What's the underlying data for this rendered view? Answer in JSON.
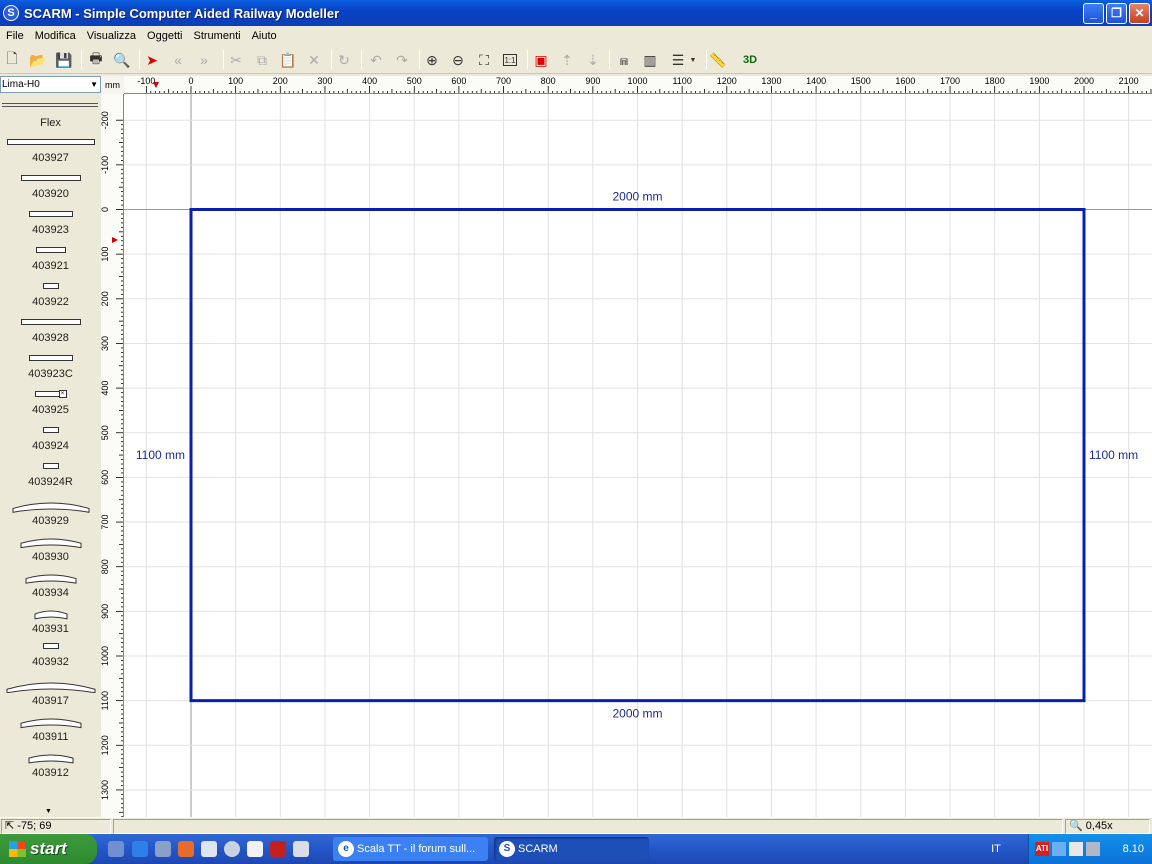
{
  "window": {
    "title": "SCARM - Simple Computer Aided Railway Modeller",
    "app_icon": "S"
  },
  "menu": [
    "File",
    "Modifica",
    "Visualizza",
    "Oggetti",
    "Strumenti",
    "Aiuto"
  ],
  "toolbar": {
    "buttons": [
      {
        "name": "new-file-icon",
        "glyph": "🗋",
        "enabled": true
      },
      {
        "name": "open-folder-icon",
        "glyph": "📂",
        "enabled": true
      },
      {
        "name": "save-icon",
        "glyph": "💾",
        "enabled": true
      },
      {
        "name": "print-icon",
        "glyph": "🖶",
        "enabled": true
      },
      {
        "name": "print-preview-icon",
        "glyph": "🔍",
        "enabled": true
      },
      {
        "name": "select-arrow-icon",
        "glyph": "➤",
        "enabled": true
      },
      {
        "name": "previous-icon",
        "glyph": "«",
        "enabled": false
      },
      {
        "name": "next-icon",
        "glyph": "»",
        "enabled": false
      },
      {
        "name": "cut-icon",
        "glyph": "✂",
        "enabled": false
      },
      {
        "name": "copy-icon",
        "glyph": "⧉",
        "enabled": false
      },
      {
        "name": "paste-icon",
        "glyph": "📋",
        "enabled": false
      },
      {
        "name": "delete-icon",
        "glyph": "✕",
        "enabled": false
      },
      {
        "name": "rotate-icon",
        "glyph": "↻",
        "enabled": false
      },
      {
        "name": "undo-icon",
        "glyph": "↶",
        "enabled": false
      },
      {
        "name": "redo-icon",
        "glyph": "↷",
        "enabled": false
      },
      {
        "name": "zoom-in-icon",
        "glyph": "⊕",
        "enabled": true
      },
      {
        "name": "zoom-out-icon",
        "glyph": "⊖",
        "enabled": true
      },
      {
        "name": "zoom-fit-icon",
        "glyph": "⛶",
        "enabled": true
      },
      {
        "name": "zoom-1-1-icon",
        "glyph": "1:1",
        "enabled": true
      },
      {
        "name": "track-layer-icon",
        "glyph": "▣",
        "enabled": true
      },
      {
        "name": "height-up-icon",
        "glyph": "⇡",
        "enabled": false
      },
      {
        "name": "height-down-icon",
        "glyph": "⇣",
        "enabled": false
      },
      {
        "name": "bridge-icon",
        "glyph": "⩎",
        "enabled": true
      },
      {
        "name": "flex-track-icon",
        "glyph": "▥",
        "enabled": true
      },
      {
        "name": "layers-icon",
        "glyph": "☰",
        "enabled": true
      },
      {
        "name": "measure-icon",
        "glyph": "📏",
        "enabled": true
      },
      {
        "name": "view-3d-icon",
        "glyph": "3D",
        "enabled": true
      }
    ]
  },
  "library": {
    "selected": "Lima-H0",
    "items": [
      {
        "label": "Flex",
        "kind": "flex"
      },
      {
        "label": "403927",
        "kind": "straight",
        "len": 0.88
      },
      {
        "label": "403920",
        "kind": "straight",
        "len": 0.6
      },
      {
        "label": "403923",
        "kind": "straight",
        "len": 0.44
      },
      {
        "label": "403921",
        "kind": "straight",
        "len": 0.3
      },
      {
        "label": "403922",
        "kind": "straight",
        "len": 0.16
      },
      {
        "label": "403928",
        "kind": "straight",
        "len": 0.6
      },
      {
        "label": "403923C",
        "kind": "straight",
        "len": 0.44
      },
      {
        "label": "403925",
        "kind": "straight",
        "len": 0.32
      },
      {
        "label": "403924",
        "kind": "straight",
        "len": 0.16
      },
      {
        "label": "403924R",
        "kind": "straight",
        "len": 0.16
      },
      {
        "label": "403929",
        "kind": "curve",
        "len": 0.76
      },
      {
        "label": "403930",
        "kind": "curve",
        "len": 0.6
      },
      {
        "label": "403934",
        "kind": "curve",
        "len": 0.5
      },
      {
        "label": "403931",
        "kind": "curve",
        "len": 0.32
      },
      {
        "label": "403932",
        "kind": "straight",
        "len": 0.16
      },
      {
        "label": "403917",
        "kind": "curve",
        "len": 0.88
      },
      {
        "label": "403911",
        "kind": "curve",
        "len": 0.6
      },
      {
        "label": "403912",
        "kind": "curve",
        "len": 0.44
      }
    ]
  },
  "ruler": {
    "unit": "mm",
    "x_ticks": [
      "-100",
      "0",
      "100",
      "200",
      "300",
      "400",
      "500",
      "600",
      "700",
      "800",
      "900",
      "1000",
      "1100",
      "1200",
      "1300",
      "1400",
      "1500",
      "1600",
      "1700",
      "1800",
      "1900",
      "2000",
      "2100"
    ],
    "y_ticks": [
      "-200",
      "-100",
      "0",
      "100",
      "200",
      "300",
      "400",
      "500",
      "600",
      "700",
      "800",
      "900",
      "1000",
      "1100",
      "1200",
      "1300"
    ]
  },
  "board": {
    "width_mm": 2000,
    "height_mm": 1100,
    "top_label": "2000 mm",
    "bottom_label": "2000 mm",
    "left_label": "1100 mm",
    "right_label": "1100 mm",
    "color": "#0a1fb0"
  },
  "status": {
    "coords": "-75; 69",
    "zoom": "0,45x"
  },
  "taskbar": {
    "start": "start",
    "tasks": [
      {
        "label": "Scala TT - il forum sull...",
        "icon": "e",
        "active": false
      },
      {
        "label": "SCARM",
        "icon": "S",
        "active": true
      }
    ],
    "language": "IT",
    "clock": "8.10"
  }
}
